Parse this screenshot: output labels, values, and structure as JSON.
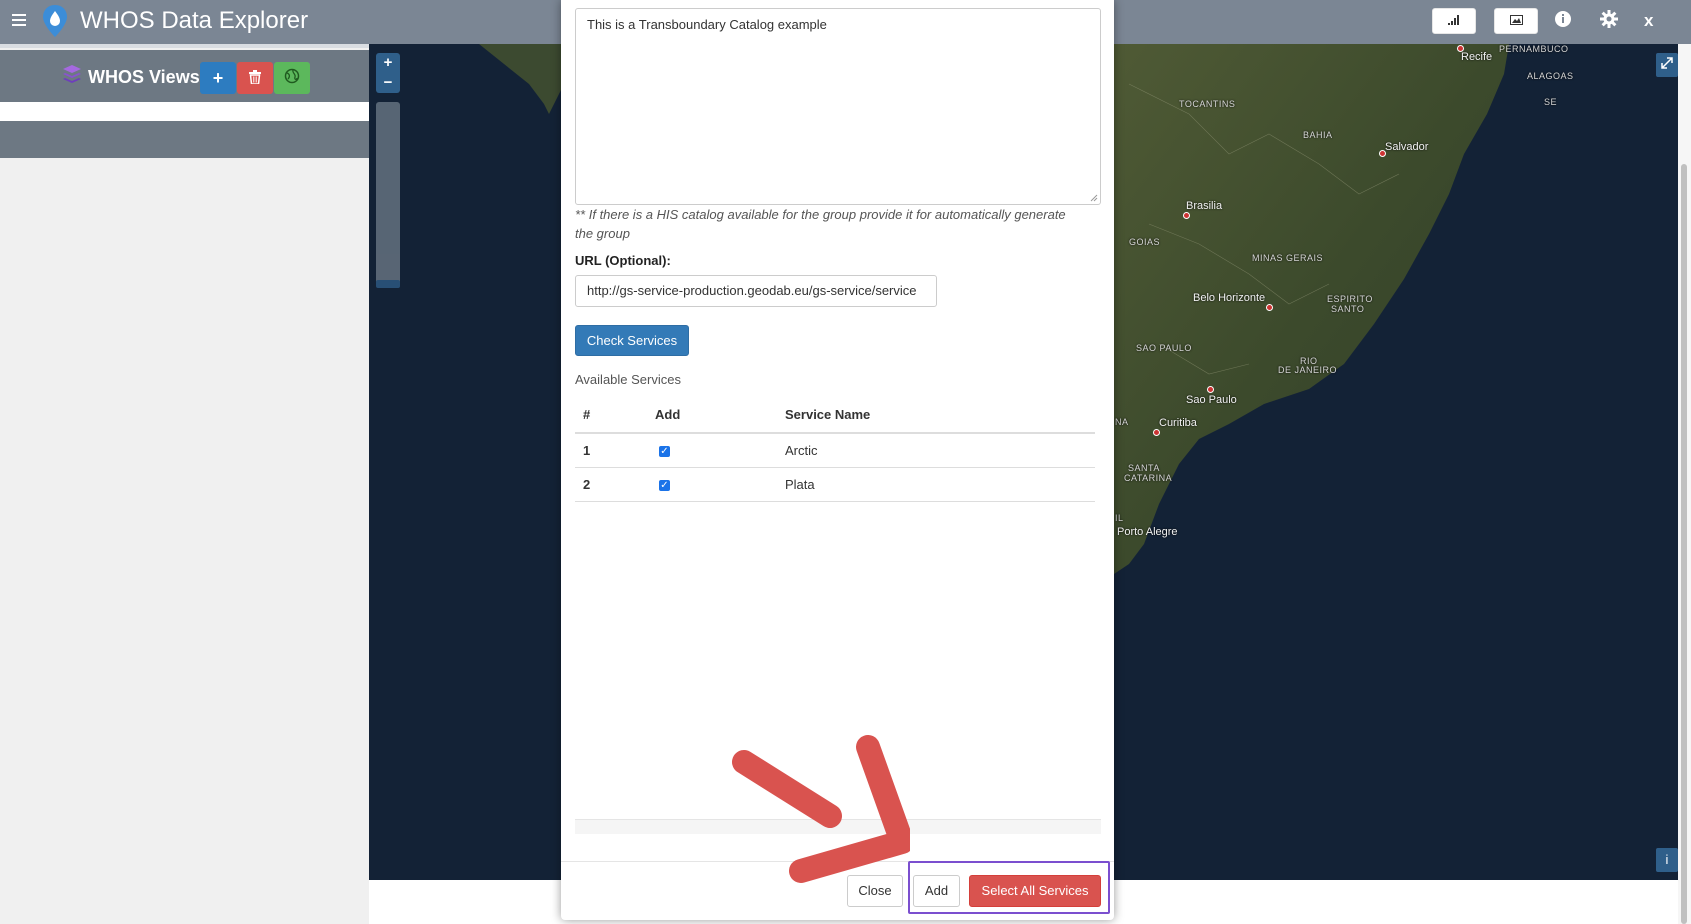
{
  "navbar": {
    "title": "WHOS Data Explorer",
    "menu_icon": "hamburger-menu-icon",
    "logo_icon": "water-drop-pin-icon",
    "right_icons": [
      "signal-bars-icon",
      "image-icon",
      "info-icon",
      "gear-icon",
      "close-icon"
    ],
    "close_label": "x"
  },
  "sidebar": {
    "views_title": "WHOS Views",
    "views_icon": "layers-icon",
    "add_button": "+",
    "delete_icon": "trash-icon",
    "globe_icon": "globe-icon"
  },
  "map": {
    "zoom_in": "+",
    "zoom_out": "−",
    "fullscreen_icon": "expand-icon",
    "info_button": "i",
    "cities": [
      "Recife",
      "Salvador",
      "Brasilia",
      "Belo Horizonte",
      "Sao Paulo",
      "Curitiba",
      "Porto Alegre"
    ],
    "states": [
      "PERNAMBUCO",
      "ALAGOAS",
      "SE",
      "TOCANTINS",
      "BAHIA",
      "GOIAS",
      "MINAS GERAIS",
      "ESPIRITO",
      "SANTO",
      "SAO PAULO",
      "RIO",
      "DE JANEIRO",
      "NA",
      "SANTA",
      "CATARINA",
      "IL"
    ]
  },
  "modal": {
    "description_value": "This is a Transboundary Catalog example",
    "hint": "** If there is a HIS catalog available for the group provide it for automatically generate the group",
    "url_label": "URL (Optional):",
    "url_value": "http://gs-service-production.geodab.eu/gs-service/service",
    "check_button": "Check Services",
    "available_services_label": "Available Services",
    "table": {
      "headers": [
        "#",
        "Add",
        "Service Name"
      ],
      "rows": [
        {
          "num": "1",
          "checked": true,
          "name": "Arctic"
        },
        {
          "num": "2",
          "checked": true,
          "name": "Plata"
        }
      ]
    },
    "close_button": "Close",
    "add_button": "Add",
    "select_all_button": "Select All Services"
  },
  "colors": {
    "navbar": "#7b8694",
    "primary": "#337ab7",
    "danger": "#d9534f",
    "success": "#5cb85c",
    "highlight": "#7b4fcf",
    "arrow": "#d9534f"
  }
}
